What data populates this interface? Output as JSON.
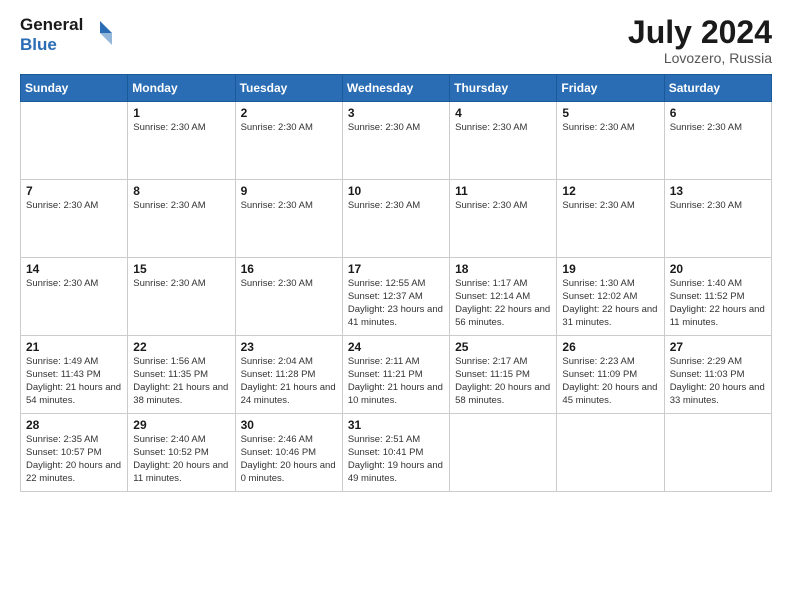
{
  "header": {
    "logo_line1": "General",
    "logo_line2": "Blue",
    "month_year": "July 2024",
    "location": "Lovozero, Russia"
  },
  "weekdays": [
    "Sunday",
    "Monday",
    "Tuesday",
    "Wednesday",
    "Thursday",
    "Friday",
    "Saturday"
  ],
  "weeks": [
    [
      {
        "day": "",
        "info": ""
      },
      {
        "day": "1",
        "info": "Sunrise: 2:30 AM"
      },
      {
        "day": "2",
        "info": "Sunrise: 2:30 AM"
      },
      {
        "day": "3",
        "info": "Sunrise: 2:30 AM"
      },
      {
        "day": "4",
        "info": "Sunrise: 2:30 AM"
      },
      {
        "day": "5",
        "info": "Sunrise: 2:30 AM"
      },
      {
        "day": "6",
        "info": "Sunrise: 2:30 AM"
      }
    ],
    [
      {
        "day": "7",
        "info": "Sunrise: 2:30 AM"
      },
      {
        "day": "8",
        "info": "Sunrise: 2:30 AM"
      },
      {
        "day": "9",
        "info": "Sunrise: 2:30 AM"
      },
      {
        "day": "10",
        "info": "Sunrise: 2:30 AM"
      },
      {
        "day": "11",
        "info": "Sunrise: 2:30 AM"
      },
      {
        "day": "12",
        "info": "Sunrise: 2:30 AM"
      },
      {
        "day": "13",
        "info": "Sunrise: 2:30 AM"
      }
    ],
    [
      {
        "day": "14",
        "info": "Sunrise: 2:30 AM"
      },
      {
        "day": "15",
        "info": "Sunrise: 2:30 AM"
      },
      {
        "day": "16",
        "info": "Sunrise: 2:30 AM"
      },
      {
        "day": "17",
        "info": "Sunrise: 12:55 AM\nSunset: 12:37 AM\nDaylight: 23 hours and 41 minutes."
      },
      {
        "day": "18",
        "info": "Sunrise: 1:17 AM\nSunset: 12:14 AM\nDaylight: 22 hours and 56 minutes."
      },
      {
        "day": "19",
        "info": "Sunrise: 1:30 AM\nSunset: 12:02 AM\nDaylight: 22 hours and 31 minutes."
      },
      {
        "day": "20",
        "info": "Sunrise: 1:40 AM\nSunset: 11:52 PM\nDaylight: 22 hours and 11 minutes."
      }
    ],
    [
      {
        "day": "21",
        "info": "Sunrise: 1:49 AM\nSunset: 11:43 PM\nDaylight: 21 hours and 54 minutes."
      },
      {
        "day": "22",
        "info": "Sunrise: 1:56 AM\nSunset: 11:35 PM\nDaylight: 21 hours and 38 minutes."
      },
      {
        "day": "23",
        "info": "Sunrise: 2:04 AM\nSunset: 11:28 PM\nDaylight: 21 hours and 24 minutes."
      },
      {
        "day": "24",
        "info": "Sunrise: 2:11 AM\nSunset: 11:21 PM\nDaylight: 21 hours and 10 minutes."
      },
      {
        "day": "25",
        "info": "Sunrise: 2:17 AM\nSunset: 11:15 PM\nDaylight: 20 hours and 58 minutes."
      },
      {
        "day": "26",
        "info": "Sunrise: 2:23 AM\nSunset: 11:09 PM\nDaylight: 20 hours and 45 minutes."
      },
      {
        "day": "27",
        "info": "Sunrise: 2:29 AM\nSunset: 11:03 PM\nDaylight: 20 hours and 33 minutes."
      }
    ],
    [
      {
        "day": "28",
        "info": "Sunrise: 2:35 AM\nSunset: 10:57 PM\nDaylight: 20 hours and 22 minutes."
      },
      {
        "day": "29",
        "info": "Sunrise: 2:40 AM\nSunset: 10:52 PM\nDaylight: 20 hours and 11 minutes."
      },
      {
        "day": "30",
        "info": "Sunrise: 2:46 AM\nSunset: 10:46 PM\nDaylight: 20 hours and 0 minutes."
      },
      {
        "day": "31",
        "info": "Sunrise: 2:51 AM\nSunset: 10:41 PM\nDaylight: 19 hours and 49 minutes."
      },
      {
        "day": "",
        "info": ""
      },
      {
        "day": "",
        "info": ""
      },
      {
        "day": "",
        "info": ""
      }
    ]
  ]
}
